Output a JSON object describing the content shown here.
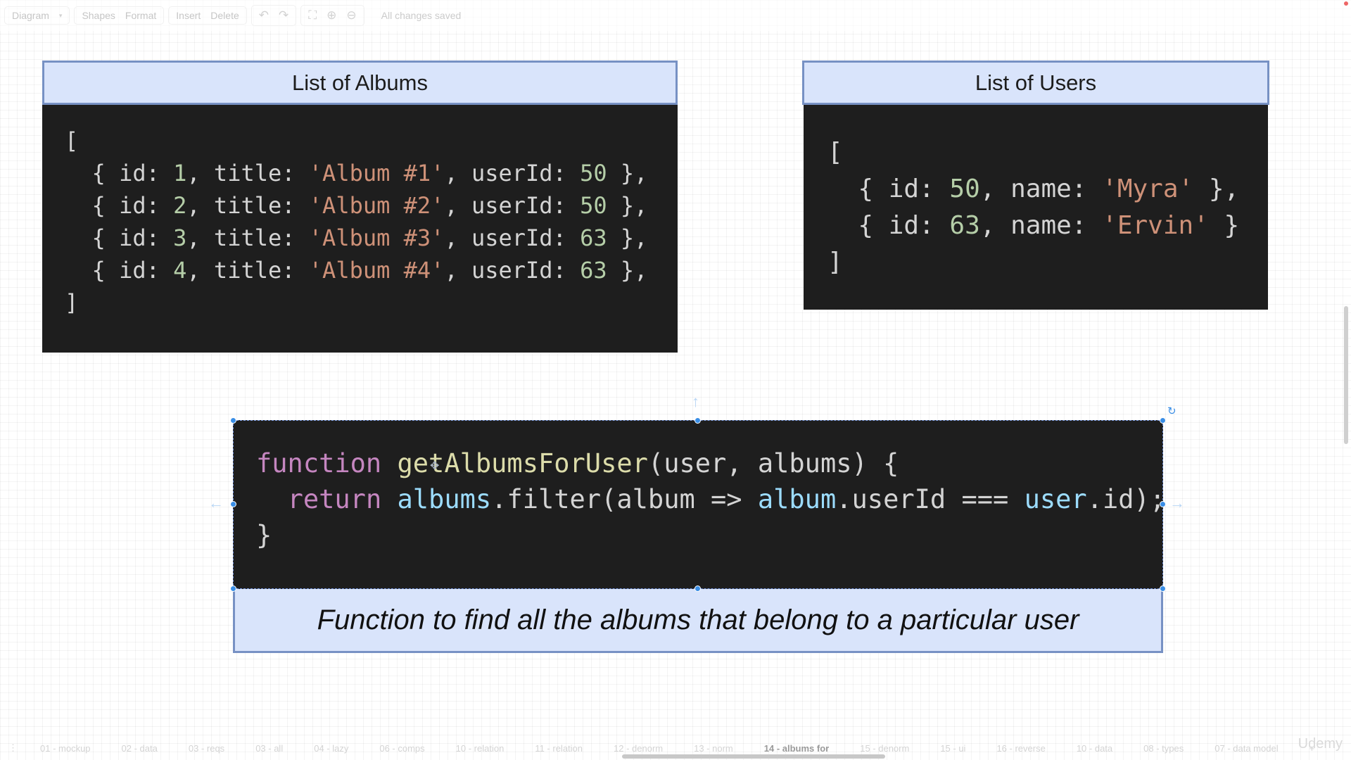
{
  "toolbar": {
    "diagram_menu": "Diagram",
    "shapes": "Shapes",
    "format": "Format",
    "insert": "Insert",
    "delete": "Delete",
    "status": "All changes saved",
    "icons": [
      "undo-icon",
      "redo-icon",
      "fullscreen-icon",
      "zoom-in-icon",
      "zoom-out-icon"
    ]
  },
  "albums_card": {
    "title": "List of Albums",
    "open_bracket": "[",
    "close_bracket": "]",
    "rows": [
      {
        "id": "1",
        "title": "'Album #1'",
        "userId": "50"
      },
      {
        "id": "2",
        "title": "'Album #2'",
        "userId": "50"
      },
      {
        "id": "3",
        "title": "'Album #3'",
        "userId": "63"
      },
      {
        "id": "4",
        "title": "'Album #4'",
        "userId": "63"
      }
    ]
  },
  "users_card": {
    "title": "List of Users",
    "open_bracket": "[",
    "close_bracket": "]",
    "rows": [
      {
        "id": "50",
        "name": "'Myra'"
      },
      {
        "id": "63",
        "name": "'Ervin'"
      }
    ]
  },
  "function_card": {
    "keyword_function": "function",
    "function_name": "getAlbumsForUser",
    "params": "(user, albums) {",
    "keyword_return": "return",
    "albums_var": "albums",
    "filter_call": ".filter(album => ",
    "album_var": "album",
    "compare": ".userId === ",
    "user_var": "user",
    "end": ".id);",
    "close_brace": "}",
    "caption": "Function to find all the albums that belong to a particular user"
  },
  "bottom_tabs": [
    "01 - mockup",
    "02 - data",
    "03 - reqs",
    "03 - all",
    "04 - lazy",
    "06 - comps",
    "10 - relation",
    "11 - relation",
    "12 - denorm",
    "13 - norm",
    "14 - albums for",
    "15 - denorm",
    "15 - ui",
    "16 - reverse",
    "10 - data",
    "08 - types",
    "07 - data model"
  ],
  "active_tab": "14 - albums for",
  "watermark": "Udemy",
  "colors": {
    "header_bg": "#d9e4fb",
    "header_border": "#7791c4",
    "code_bg": "#1e1e1e",
    "string": "#ce9178",
    "number": "#b5cea8",
    "keyword": "#c586c0",
    "function": "#dcdcaa",
    "variable": "#9cdcfe",
    "selection": "#3a8ee6"
  }
}
